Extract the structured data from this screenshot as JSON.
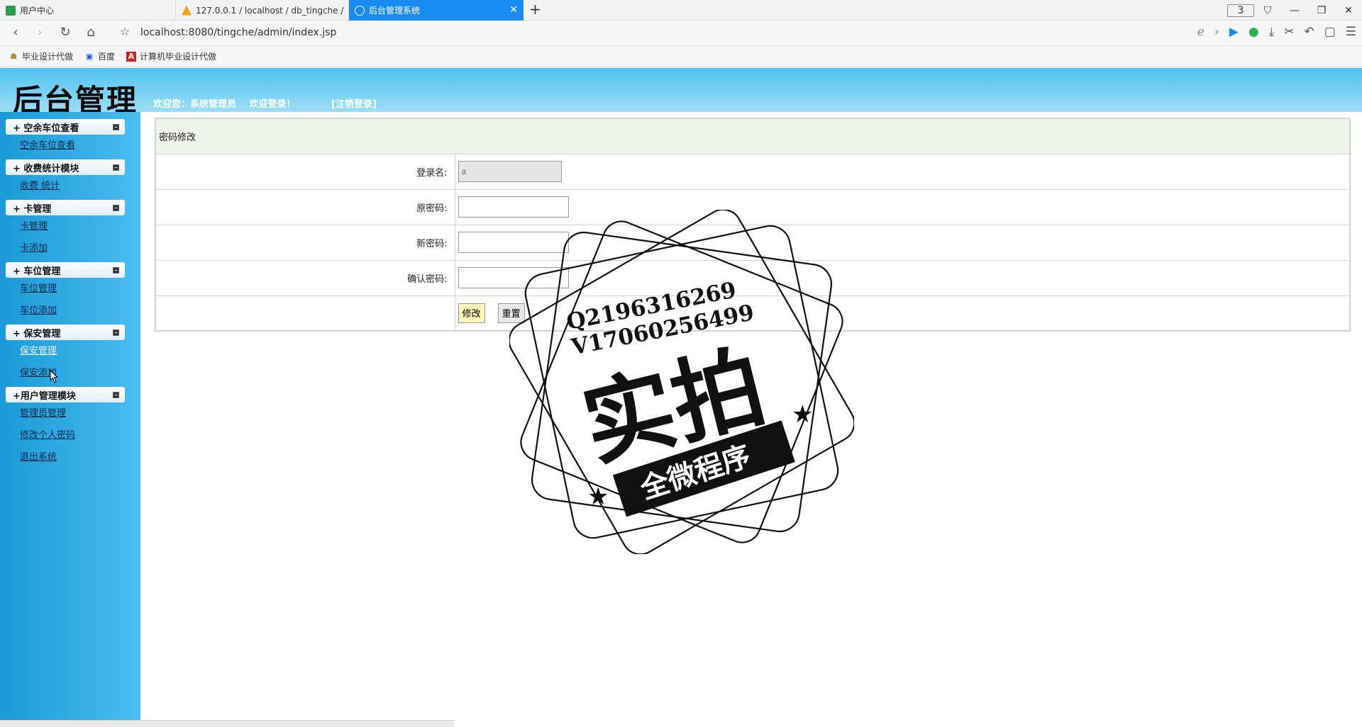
{
  "browser": {
    "tabs": [
      {
        "label": "用户中心"
      },
      {
        "label": "127.0.0.1 / localhost / db_tingche /"
      },
      {
        "label": "后台管理系统"
      }
    ],
    "tab_count": "3",
    "url": "localhost:8080/tingche/admin/index.jsp",
    "bookmarks": [
      {
        "label": "毕业设计代做"
      },
      {
        "label": "百度"
      },
      {
        "label": "计算机毕业设计代做"
      }
    ]
  },
  "header": {
    "logo": "后台管理",
    "welcome": "欢迎您：系统管理员",
    "welcome_login": "欢迎登录！",
    "logout": "[注销登录]"
  },
  "sidebar": {
    "groups": [
      {
        "title": "+ 空余车位查看",
        "items": [
          "空余车位查看"
        ]
      },
      {
        "title": "+ 收费统计模块",
        "items": [
          "收费 统计"
        ]
      },
      {
        "title": "+ 卡管理",
        "items": [
          "卡管理",
          "卡添加"
        ]
      },
      {
        "title": "+ 车位管理",
        "items": [
          "车位管理",
          "车位添加"
        ]
      },
      {
        "title": "+ 保安管理",
        "items": [
          "保安管理",
          "保安添加"
        ]
      },
      {
        "title": "+用户管理模块",
        "items": [
          "管理员管理",
          "修改个人密码",
          "退出系统"
        ]
      }
    ]
  },
  "form": {
    "title": "密码修改",
    "login_label": "登录名:",
    "login_value": "a",
    "old_pwd_label": "原密码:",
    "new_pwd_label": "新密码:",
    "confirm_pwd_label": "确认密码:",
    "submit": "修改",
    "reset": "重置"
  },
  "watermark": {
    "line1": "Q2196316269",
    "line2": "V17060256499",
    "big": "实拍",
    "banner": "全微程序"
  }
}
